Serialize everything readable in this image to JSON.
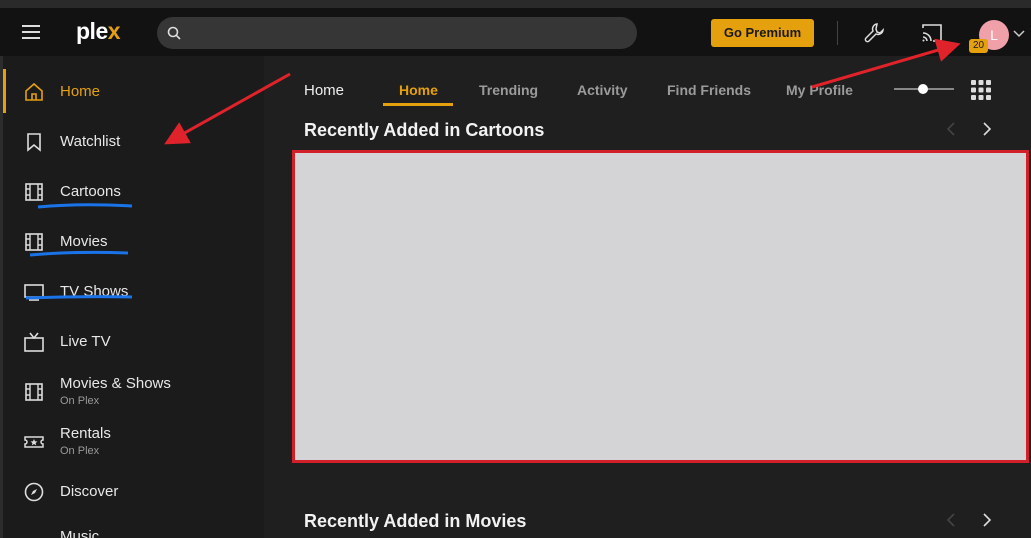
{
  "topbar": {
    "logo_text": "ple",
    "logo_accent": "x",
    "search_placeholder": "",
    "premium_label": "Go Premium",
    "avatar_initial": "L",
    "notification_count": "20"
  },
  "sidebar": {
    "items": [
      {
        "label": "Home",
        "icon": "home-icon",
        "active": true
      },
      {
        "label": "Watchlist",
        "icon": "bookmark-icon"
      },
      {
        "label": "Cartoons",
        "icon": "film-icon"
      },
      {
        "label": "Movies",
        "icon": "film-icon"
      },
      {
        "label": "TV Shows",
        "icon": "monitor-icon"
      },
      {
        "label": "Live TV",
        "icon": "tv-icon"
      },
      {
        "label": "Movies & Shows",
        "sub": "On Plex",
        "icon": "film-icon"
      },
      {
        "label": "Rentals",
        "sub": "On Plex",
        "icon": "ticket-icon"
      },
      {
        "label": "Discover",
        "icon": "compass-icon"
      },
      {
        "label": "Music",
        "icon": "music-icon"
      }
    ]
  },
  "main": {
    "breadcrumb": "Home",
    "tabs": [
      "Home",
      "Trending",
      "Activity",
      "Find Friends",
      "My Profile"
    ],
    "active_tab": "Home",
    "sections": [
      "Recently Added in Cartoons",
      "Recently Added in Movies"
    ]
  },
  "colors": {
    "accent": "#e5a00d",
    "highlight_box": "#d2202a",
    "arrow": "#e0232a",
    "underline": "#1a73e8"
  }
}
